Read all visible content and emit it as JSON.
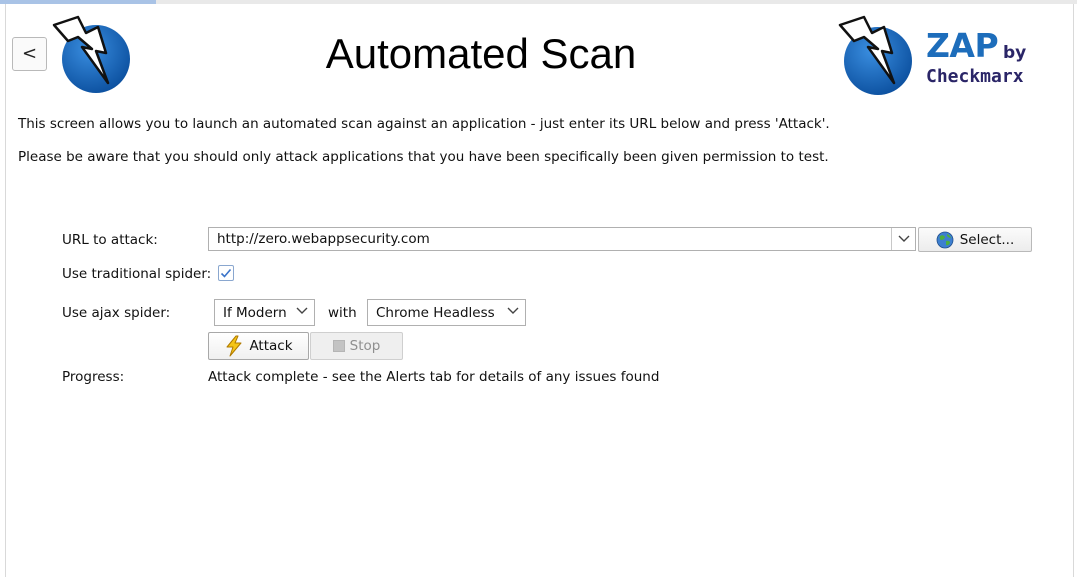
{
  "header": {
    "back_label": "<",
    "title": "Automated Scan",
    "brand_name": "ZAP",
    "brand_by": "by",
    "brand_company": "Checkmarx"
  },
  "description": {
    "line1": "This screen allows you to launch an automated scan against  an application - just enter its URL below and press 'Attack'.",
    "line2": "Please be aware that you should only attack applications that you have been specifically been given permission to test."
  },
  "form": {
    "url_label": "URL to attack:",
    "url_value": "http://zero.webappsecurity.com",
    "select_label": "Select...",
    "traditional_spider_label": "Use traditional spider:",
    "traditional_spider_checked": true,
    "ajax_spider_label": "Use ajax spider:",
    "ajax_mode": "If Modern",
    "with_label": "with",
    "browser": "Chrome Headless",
    "attack_label": "Attack",
    "stop_label": "Stop",
    "progress_label": "Progress:",
    "progress_value": "Attack complete - see the Alerts tab for details of any issues found"
  },
  "icons": {
    "back": "chevron-left-icon",
    "zap_logo": "lightning-globe-logo",
    "dropdown": "chevron-down-icon",
    "select": "globe-icon",
    "attack": "lightning-icon",
    "stop": "stop-icon",
    "check": "checkmark-icon"
  },
  "colors": {
    "brand_blue": "#1d6dbb",
    "brand_navy": "#2a2567",
    "checkbox_check": "#3b74c9"
  }
}
